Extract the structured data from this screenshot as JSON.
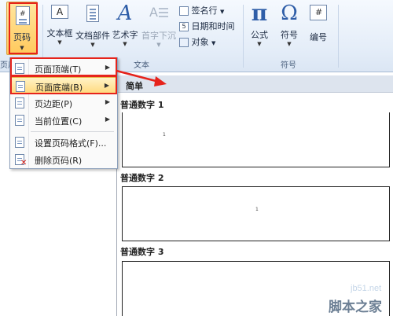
{
  "ribbon": {
    "page_number_button": "页码",
    "text_box_button": "文本框",
    "quick_parts_button": "文档部件",
    "wordart_button": "艺术字",
    "drop_cap_button": "首字下沉",
    "signature_line": "签名行",
    "date_time": "日期和时间",
    "object": "对象",
    "equation_button": "公式",
    "symbol_button": "符号",
    "number_button": "编号",
    "group_text": "文本",
    "group_symbols": "符号",
    "left_partial_group": "页眉",
    "equation_glyph": "π",
    "symbol_glyph": "Ω",
    "number_glyph": "#",
    "wordart_glyph": "A"
  },
  "menu": {
    "items": [
      {
        "label": "页面顶端(T)",
        "has_submenu": true
      },
      {
        "label": "页面底端(B)",
        "has_submenu": true,
        "highlighted": true
      },
      {
        "label": "页边距(P)",
        "has_submenu": true
      },
      {
        "label": "当前位置(C)",
        "has_submenu": true
      },
      {
        "label": "设置页码格式(F)...",
        "has_submenu": false
      },
      {
        "label": "删除页码(R)",
        "has_submenu": false
      }
    ]
  },
  "gallery": {
    "header": "简单",
    "items": [
      {
        "title": "普通数字 1",
        "page_number": "1"
      },
      {
        "title": "普通数字 2",
        "page_number": "1"
      },
      {
        "title": "普通数字 3",
        "page_number": ""
      }
    ]
  },
  "watermark": {
    "site": "jb51.net",
    "name": "脚本之家"
  }
}
